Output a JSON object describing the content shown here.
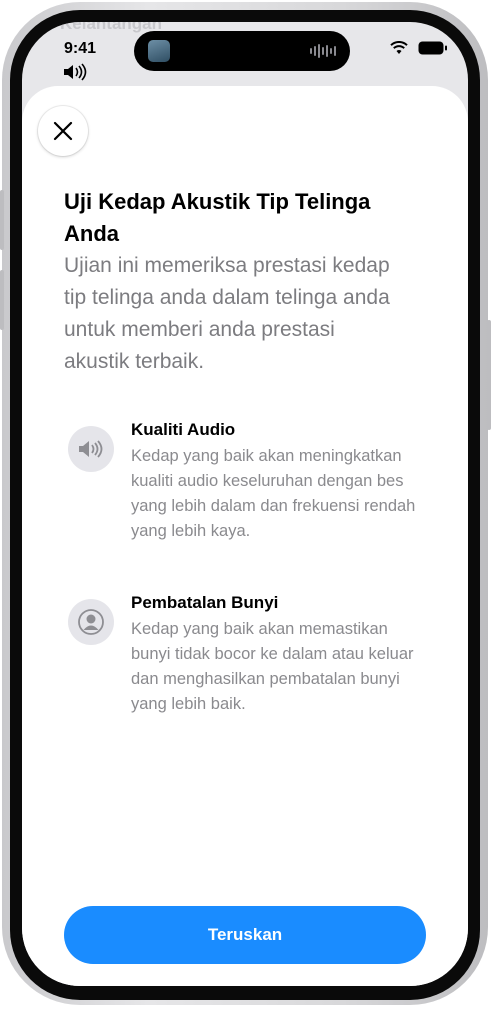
{
  "background": {
    "app_label": "Kelantangan"
  },
  "status_bar": {
    "time": "9:41",
    "volume_icon": "speaker-wave-icon",
    "signal": "wifi-icon",
    "battery": "battery-icon"
  },
  "sheet": {
    "title": "Uji Kedap Akustik Tip Telinga Anda",
    "subtitle": "Ujian ini memeriksa prestasi kedap tip telinga anda dalam telinga anda untuk memberi anda prestasi akustik terbaik.",
    "features": [
      {
        "icon": "speaker-icon",
        "title": "Kualiti Audio",
        "description": "Kedap yang baik akan meningkatkan kualiti audio keseluruhan dengan bes yang lebih dalam dan frekuensi rendah yang lebih kaya."
      },
      {
        "icon": "person-noise-cancel-icon",
        "title": "Pembatalan Bunyi",
        "description": "Kedap yang baik akan memastikan bunyi tidak bocor ke dalam atau keluar dan menghasilkan pembatalan bunyi yang lebih baik."
      }
    ],
    "continue_label": "Teruskan"
  },
  "colors": {
    "accent": "#1a8cff",
    "secondary_text": "#7c7c80",
    "icon_bg": "#e5e5ea"
  }
}
